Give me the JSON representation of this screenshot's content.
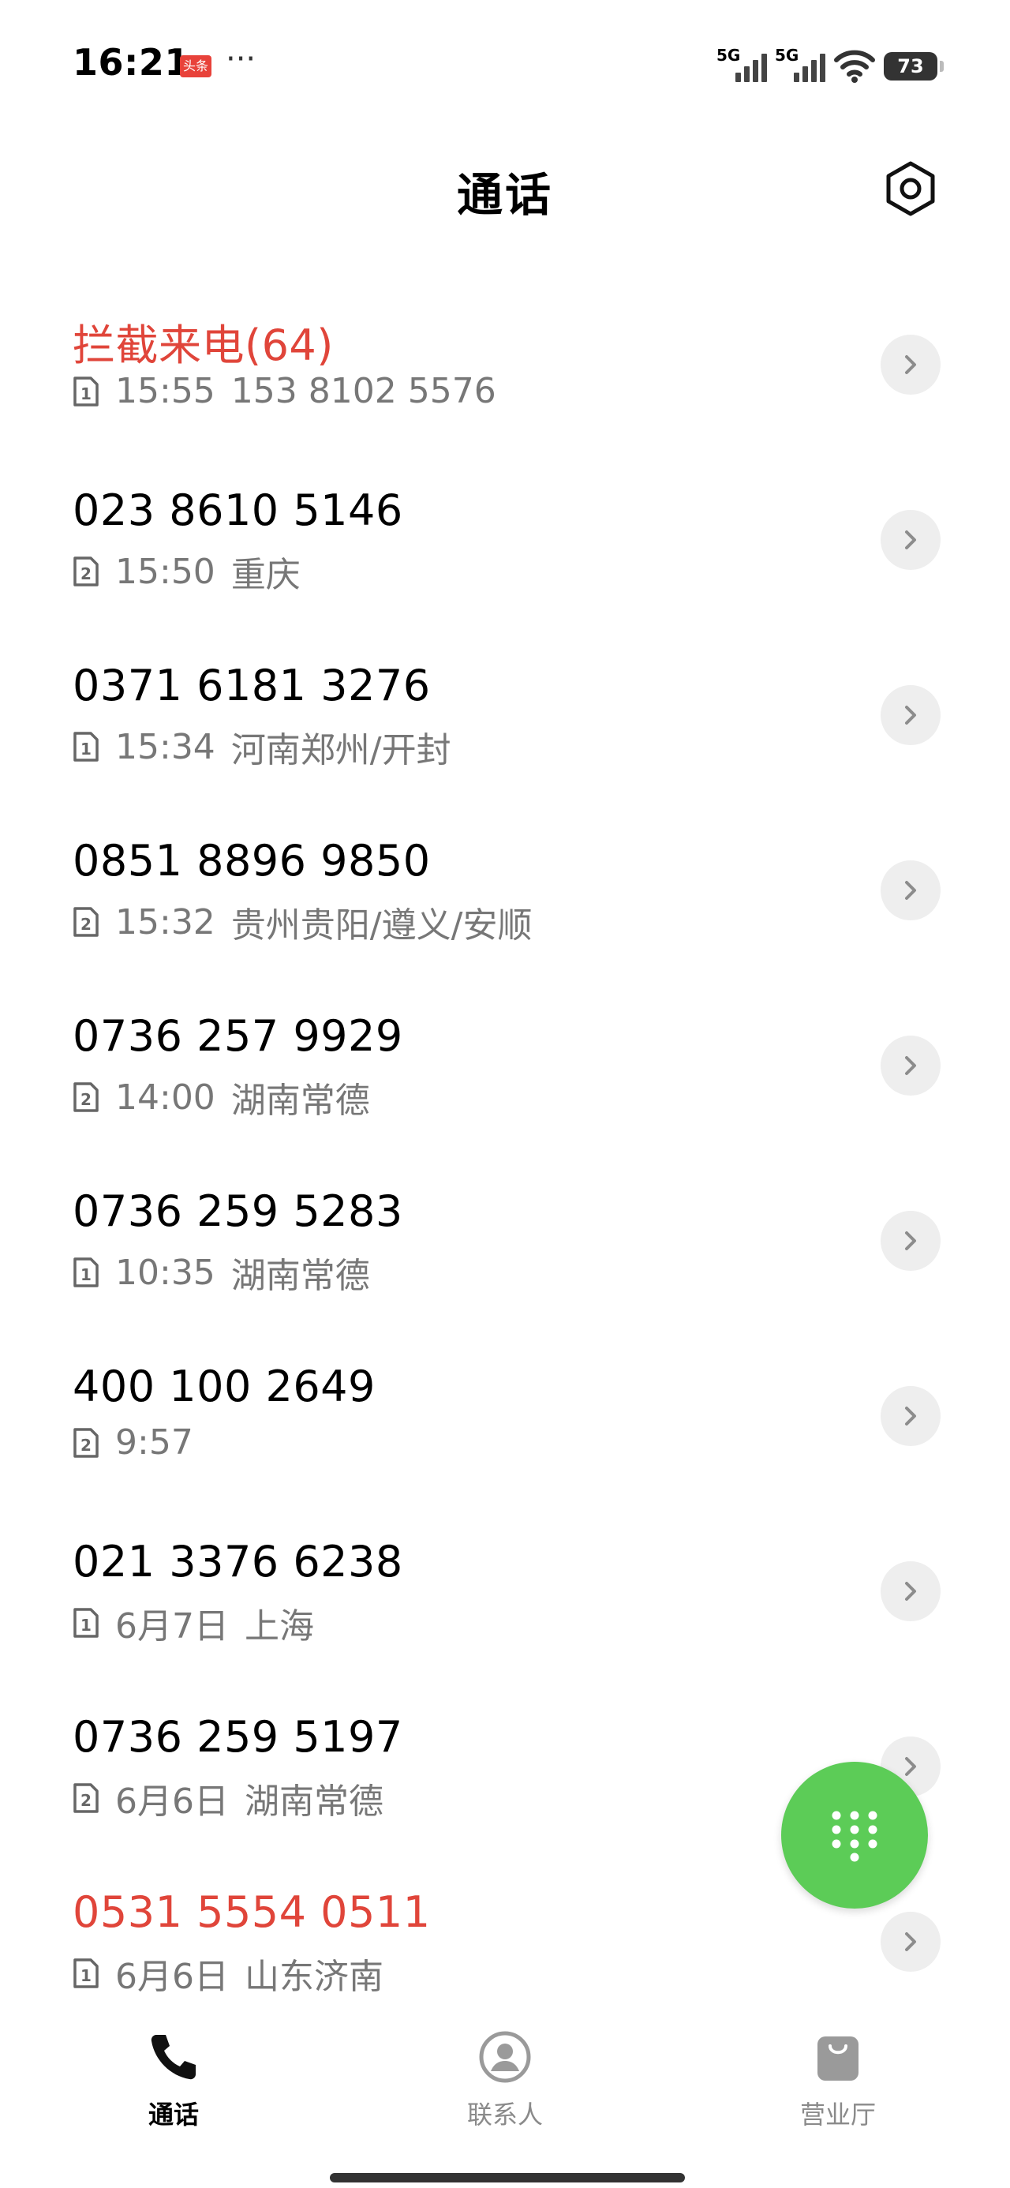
{
  "status_bar": {
    "time": "16:21",
    "app_badge": "头条",
    "more_dots": "···",
    "sim1_network": "5G",
    "sim2_network": "5G",
    "battery_level": "73"
  },
  "header": {
    "title": "通话"
  },
  "calls": [
    {
      "name": "拦截来电(64)",
      "sim": "1",
      "time": "15:55",
      "detail": "153 8102 5576",
      "missed": true
    },
    {
      "name": "023 8610 5146",
      "sim": "2",
      "time": "15:50",
      "detail": "重庆",
      "missed": false
    },
    {
      "name": "0371 6181 3276",
      "sim": "1",
      "time": "15:34",
      "detail": "河南郑州/开封",
      "missed": false
    },
    {
      "name": "0851 8896 9850",
      "sim": "2",
      "time": "15:32",
      "detail": "贵州贵阳/遵义/安顺",
      "missed": false
    },
    {
      "name": "0736 257 9929",
      "sim": "2",
      "time": "14:00",
      "detail": "湖南常德",
      "missed": false
    },
    {
      "name": "0736 259 5283",
      "sim": "1",
      "time": "10:35",
      "detail": "湖南常德",
      "missed": false
    },
    {
      "name": "400 100 2649",
      "sim": "2",
      "time": "9:57",
      "detail": "",
      "missed": false
    },
    {
      "name": "021 3376 6238",
      "sim": "1",
      "time": "6月7日",
      "detail": "上海",
      "missed": false
    },
    {
      "name": "0736 259 5197",
      "sim": "2",
      "time": "6月6日",
      "detail": "湖南常德",
      "missed": false
    },
    {
      "name": "0531 5554 0511",
      "sim": "1",
      "time": "6月6日",
      "detail": "山东济南",
      "missed": true
    }
  ],
  "bottom_nav": {
    "calls_label": "通话",
    "contacts_label": "联系人",
    "store_label": "营业厅"
  },
  "colors": {
    "missed": "#e0453a",
    "fab": "#5ccc57",
    "secondary_text": "#777777"
  },
  "icons": {
    "settings": "settings-icon",
    "chevron": "chevron-right-icon",
    "dialpad": "dialpad-icon",
    "phone": "phone-icon",
    "contacts": "contacts-icon",
    "store": "store-bag-icon"
  }
}
